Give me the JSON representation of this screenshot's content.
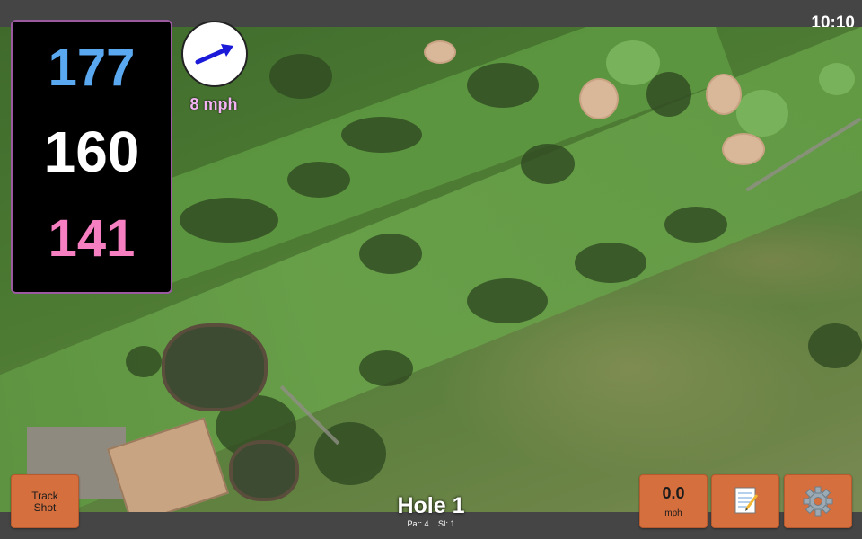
{
  "status": {
    "time": "10:10"
  },
  "yardages": {
    "back": "177",
    "middle": "160",
    "front": "141"
  },
  "wind": {
    "speed": "8 mph",
    "icon": "wind-direction-arrow-icon"
  },
  "hole": {
    "title": "Hole 1",
    "par": "Par: 4",
    "stroke_index": "SI: 1"
  },
  "buttons": {
    "track_shot": [
      "Track",
      "Shot"
    ],
    "speed_value": "0.0",
    "speed_unit": "mph",
    "notes_icon": "notepad-icon",
    "settings_icon": "gear-icon"
  },
  "colors": {
    "accent_button": "#d56f3e",
    "back_yardage": "#5aa9f0",
    "mid_yardage": "#ffffff",
    "front_yardage": "#f57fc0",
    "panel_border": "#9b5aa0"
  }
}
